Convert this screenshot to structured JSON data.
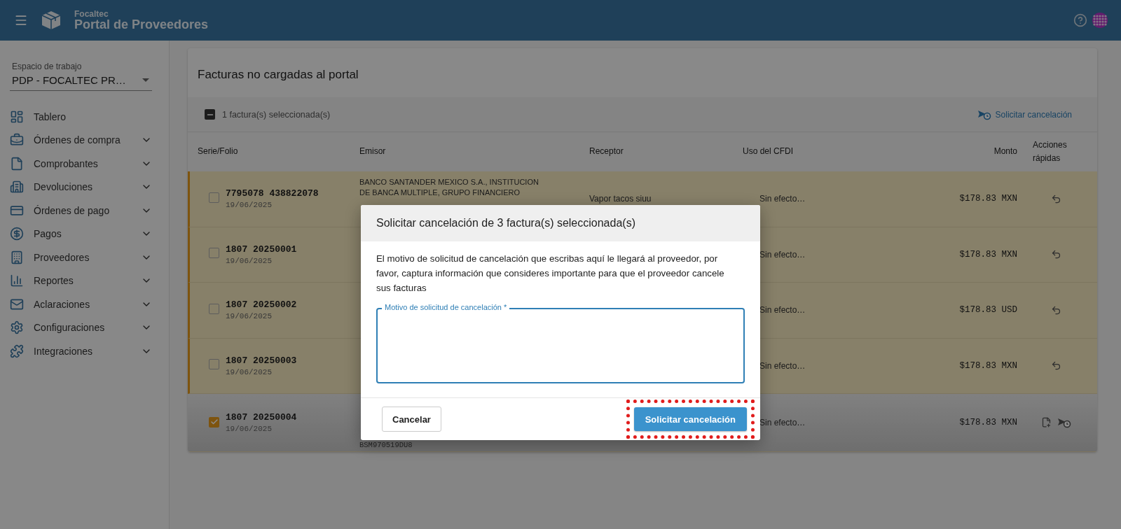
{
  "header": {
    "brand_small": "Focaltec",
    "brand": "Portal de Proveedores"
  },
  "sidebar": {
    "workspace_label": "Espacio de trabajo",
    "workspace_value": "PDP - FOCALTEC PR…",
    "items": [
      {
        "label": "Tablero",
        "expandable": false
      },
      {
        "label": "Órdenes de compra",
        "expandable": true
      },
      {
        "label": "Comprobantes",
        "expandable": true
      },
      {
        "label": "Devoluciones",
        "expandable": true
      },
      {
        "label": "Órdenes de pago",
        "expandable": true
      },
      {
        "label": "Pagos",
        "expandable": true
      },
      {
        "label": "Proveedores",
        "expandable": true
      },
      {
        "label": "Reportes",
        "expandable": true
      },
      {
        "label": "Aclaraciones",
        "expandable": true
      },
      {
        "label": "Configuraciones",
        "expandable": true
      },
      {
        "label": "Integraciones",
        "expandable": true
      }
    ]
  },
  "panel": {
    "title": "Facturas no cargadas al portal",
    "toolbar": {
      "indeterminate": true,
      "selection_text": "1 factura(s) seleccionada(s)",
      "action": "Solicitar cancelación"
    },
    "table": {
      "columns": [
        "Serie/Folio",
        "Emisor",
        "Receptor",
        "Uso del CFDI",
        "Monto",
        "Acciones rápidas"
      ],
      "rows": [
        {
          "flagged": true,
          "checked": false,
          "folio": "7795078 438822078",
          "date": "19/06/2025",
          "emisor": "BANCO SANTANDER MEXICO S.A., INSTITUCION DE BANCA MULTIPLE, GRUPO FINANCIERO",
          "receptor": "Vapor tacos siuu",
          "uso": "Sin efecto…",
          "monto": "$178.83 MXN",
          "actions": [
            {
              "kind": "undo"
            }
          ]
        },
        {
          "flagged": true,
          "checked": false,
          "folio": "1807 20250001",
          "date": "19/06/2025",
          "uso": "Sin efecto…",
          "monto": "$178.83 MXN",
          "actions": [
            {
              "kind": "undo"
            }
          ]
        },
        {
          "flagged": true,
          "checked": false,
          "folio": "1807 20250002",
          "date": "19/06/2025",
          "uso": "Sin efecto…",
          "monto": "$178.83 USD",
          "actions": [
            {
              "kind": "undo"
            }
          ]
        },
        {
          "flagged": true,
          "checked": false,
          "folio": "1807 20250003",
          "date": "19/06/2025",
          "uso": "Sin efecto…",
          "monto": "$178.83 MXN",
          "actions": [
            {
              "kind": "undo"
            }
          ]
        },
        {
          "flagged": false,
          "checked": true,
          "folio": "1807 20250004",
          "date": "19/06/2025",
          "emisor_rfc": "BSM970519DU8",
          "uso": "Sin efecto…",
          "monto": "$178.83 MXN",
          "actions": [
            {
              "kind": "add-note"
            },
            {
              "kind": "cancel-request"
            }
          ]
        }
      ]
    }
  },
  "dialog": {
    "title": "Solicitar cancelación de 3 factura(s) seleccionada(s)",
    "message": "El motivo de solicitud de cancelación que escribas aquí le llegará al proveedor, por favor, captura información que consideres importante para que el proveedor cancele sus facturas",
    "field_label": "Motivo de solicitud de cancelación *",
    "cancel": "Cancelar",
    "submit": {
      "label": "Solicitar cancelación",
      "highlighted": true
    }
  }
}
